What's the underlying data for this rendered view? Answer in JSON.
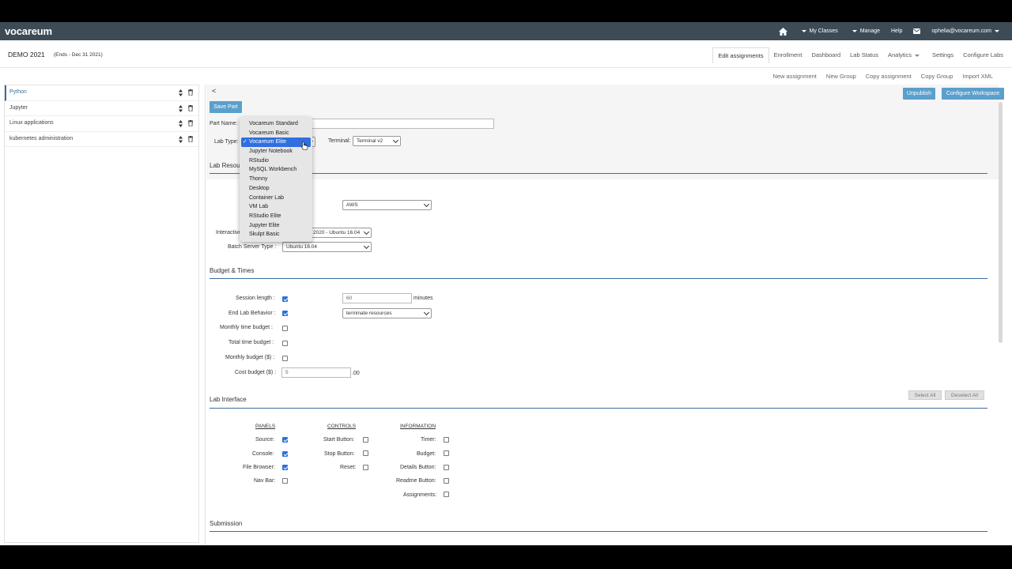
{
  "navbar": {
    "brand": "vocareum",
    "items": [
      "My Classes",
      "Manage",
      "Help"
    ],
    "user": "ophelia@vocareum.com"
  },
  "course": {
    "title": "DEMO 2021",
    "ends": "(Ends - Dec 31 2021)"
  },
  "tabs": [
    "Edit assignments",
    "Enrollment",
    "Dashboard",
    "Lab Status",
    "Analytics",
    "Settings",
    "Configure Labs"
  ],
  "actions": [
    "New assignment",
    "New Group",
    "Copy assignment",
    "Copy Group",
    "Import XML"
  ],
  "sidebar": {
    "items": [
      "Python",
      "Jupyter",
      "Linux applications",
      "kubernetes administration"
    ]
  },
  "main": {
    "back": "<",
    "save_part": "Save Part",
    "unpublish": "Unpublish",
    "configure_workspace": "Configure Workspace",
    "part_name_label": "Part Name:",
    "lab_type_label": "Lab Type:",
    "terminal_label": "Terminal:",
    "terminal_value": "Terminal v2",
    "lab_resources_title": "Lab Resou",
    "cloud_value": "AWS",
    "interactive_label": "Interactive",
    "interactive_value": "2020 - Ubuntu 16.04",
    "batch_label": "Batch Server Type :",
    "batch_value": "Ubuntu 16.04",
    "budget_title": "Budget & Times",
    "session_length_label": "Session length :",
    "session_length_value": "60",
    "minutes": "minutes",
    "end_lab_label": "End Lab Behavior :",
    "end_lab_value": "terminate resources",
    "monthly_time_label": "Monthly time budget :",
    "total_time_label": "Total time budget :",
    "monthly_budget_label": "Monthly budget ($) :",
    "cost_budget_label": "Cost budget ($) :",
    "cost_budget_value": "5",
    "cost_suffix": ".00",
    "interface_title": "Lab Interface",
    "select_all": "Select All",
    "deselect_all": "Deselect All",
    "panels_head": "PANELS",
    "controls_head": "CONTROLS",
    "information_head": "INFORMATION",
    "panels": [
      "Source:",
      "Console:",
      "File Browser:",
      "Nav Bar:"
    ],
    "controls": [
      "Start Button:",
      "Stop Button:",
      "Reset:"
    ],
    "information": [
      "Timer:",
      "Budget:",
      "Details Button:",
      "Readme Button:",
      "Assignments:"
    ],
    "submission_title": "Submission"
  },
  "dropdown": {
    "selected": "Vocareum Elite",
    "items": [
      "Vocareum Standard",
      "Vocareum Basic",
      "Vocareum Elite",
      "Jupyter Notebook",
      "RStudio",
      "MySQL Workbench",
      "Thonny",
      "Desktop",
      "Container Lab",
      "VM Lab",
      "RStudio Elite",
      "Jupyter Elite",
      "Skulpt Basic"
    ]
  },
  "colors": {
    "navbar": "#3d4b56",
    "accent": "#5b9fcc",
    "rule": "#3d6e9e",
    "selection": "#2f6fe0"
  }
}
